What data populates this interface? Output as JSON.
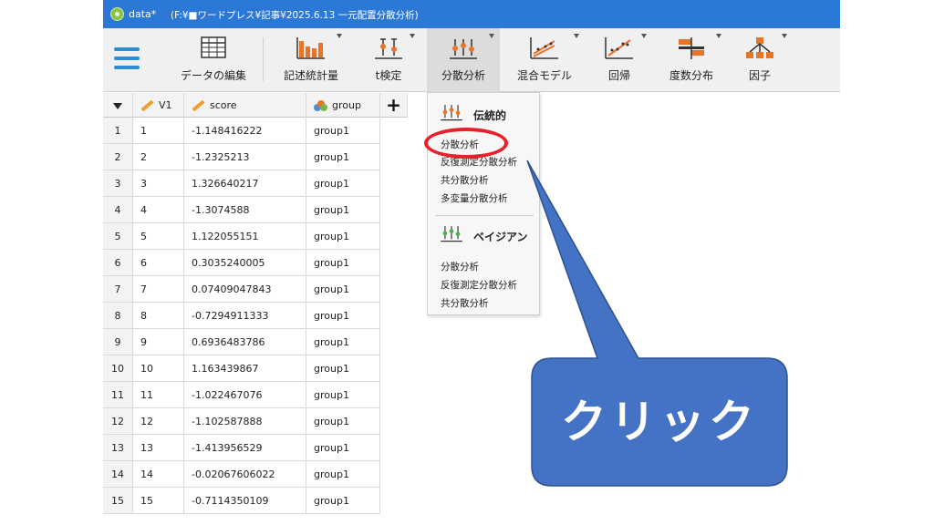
{
  "titlebar": {
    "app_name": "data*",
    "path": "(F:¥■ワードプレス¥記事¥2025.6.13 一元配置分散分析)"
  },
  "ribbon": {
    "items": [
      {
        "label": "データの編集",
        "icon": "spreadsheet-icon"
      },
      {
        "label": "記述統計量",
        "icon": "bar-chart-icon"
      },
      {
        "label": "t検定",
        "icon": "t-test-icon"
      },
      {
        "label": "分散分析",
        "icon": "anova-icon"
      },
      {
        "label": "混合モデル",
        "icon": "mixed-model-icon"
      },
      {
        "label": "回帰",
        "icon": "regression-icon"
      },
      {
        "label": "度数分布",
        "icon": "frequency-icon"
      },
      {
        "label": "因子",
        "icon": "factor-icon"
      }
    ]
  },
  "grid": {
    "columns": [
      "V1",
      "score",
      "group"
    ],
    "rows": [
      {
        "n": "1",
        "v1": "1",
        "score": "-1.148416222",
        "group": "group1"
      },
      {
        "n": "2",
        "v1": "2",
        "score": "-1.2325213",
        "group": "group1"
      },
      {
        "n": "3",
        "v1": "3",
        "score": "1.326640217",
        "group": "group1"
      },
      {
        "n": "4",
        "v1": "4",
        "score": "-1.3074588",
        "group": "group1"
      },
      {
        "n": "5",
        "v1": "5",
        "score": "1.122055151",
        "group": "group1"
      },
      {
        "n": "6",
        "v1": "6",
        "score": "0.3035240005",
        "group": "group1"
      },
      {
        "n": "7",
        "v1": "7",
        "score": "0.07409047843",
        "group": "group1"
      },
      {
        "n": "8",
        "v1": "8",
        "score": "-0.7294911333",
        "group": "group1"
      },
      {
        "n": "9",
        "v1": "9",
        "score": "0.6936483786",
        "group": "group1"
      },
      {
        "n": "10",
        "v1": "10",
        "score": "1.163439867",
        "group": "group1"
      },
      {
        "n": "11",
        "v1": "11",
        "score": "-1.022467076",
        "group": "group1"
      },
      {
        "n": "12",
        "v1": "12",
        "score": "-1.102587888",
        "group": "group1"
      },
      {
        "n": "13",
        "v1": "13",
        "score": "-1.413956529",
        "group": "group1"
      },
      {
        "n": "14",
        "v1": "14",
        "score": "-0.02067606022",
        "group": "group1"
      },
      {
        "n": "15",
        "v1": "15",
        "score": "-0.7114350109",
        "group": "group1"
      }
    ]
  },
  "dropdown": {
    "classical_header": "伝統的",
    "classical_items": [
      "分散分析",
      "反復測定分散分析",
      "共分散分析",
      "多変量分散分析"
    ],
    "bayesian_header": "ベイジアン",
    "bayesian_items": [
      "分散分析",
      "反復測定分散分析",
      "共分散分析"
    ]
  },
  "callout": {
    "text": "クリック",
    "color": "#4472c4"
  },
  "colors": {
    "titlebar": "#2b78d6",
    "highlight": "#e8202a",
    "accent": "#2b8ed6"
  }
}
